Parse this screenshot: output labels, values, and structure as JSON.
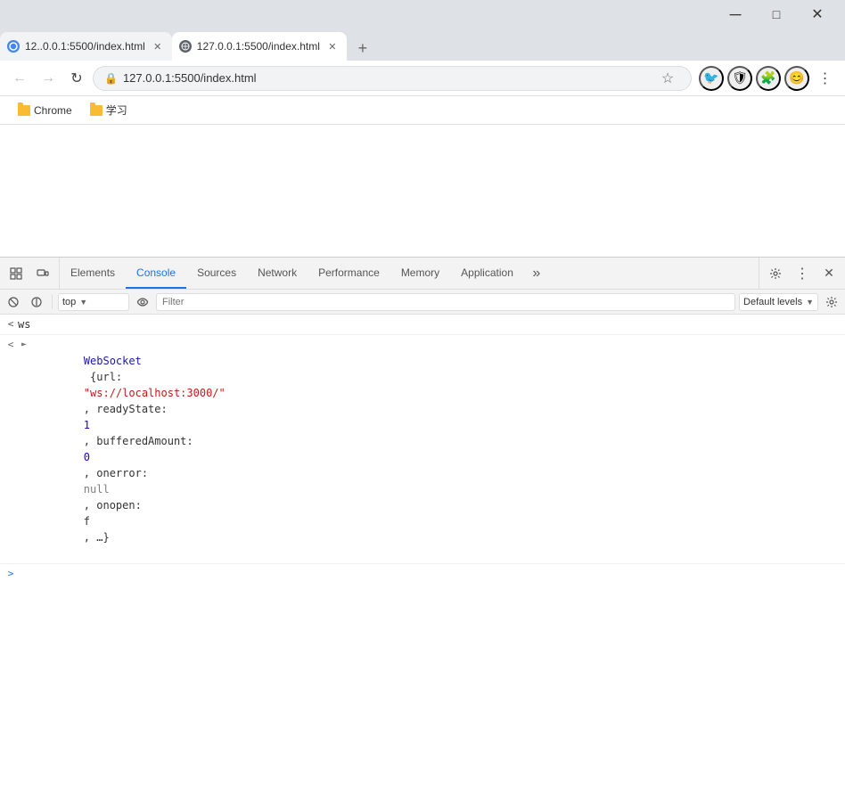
{
  "window": {
    "min_btn": "─",
    "max_btn": "□",
    "close_btn": "✕"
  },
  "tabs": [
    {
      "id": "tab1",
      "favicon": "loading",
      "title": "12..0.0.1:5500/index.html",
      "active": false,
      "url": "127.0.0.1:5500/index.html"
    },
    {
      "id": "tab2",
      "favicon": "globe",
      "title": "127.0.0.1:5500/index.html",
      "active": true,
      "url": "127.0.0.1:5500/index.html"
    }
  ],
  "new_tab_label": "+",
  "navbar": {
    "back_disabled": true,
    "forward_disabled": true,
    "reload": "↻",
    "address": "127.0.0.1:5500/index.html",
    "full_address": "http://127.0.0.1:5500/index.html",
    "star": "☆",
    "extensions": [
      "🐦",
      "🛡",
      "🧩",
      "😊"
    ],
    "menu": "⋮"
  },
  "bookmarks": [
    {
      "label": "Chrome",
      "type": "folder"
    },
    {
      "label": "学习",
      "type": "folder"
    }
  ],
  "devtools": {
    "tabs": [
      {
        "id": "elements",
        "label": "Elements",
        "active": false
      },
      {
        "id": "console",
        "label": "Console",
        "active": true
      },
      {
        "id": "sources",
        "label": "Sources",
        "active": false
      },
      {
        "id": "network",
        "label": "Network",
        "active": false
      },
      {
        "id": "performance",
        "label": "Performance",
        "active": false
      },
      {
        "id": "memory",
        "label": "Memory",
        "active": false
      },
      {
        "id": "application",
        "label": "Application",
        "active": false
      }
    ],
    "more_tabs_label": "»",
    "toolbar": {
      "context": "top",
      "filter_placeholder": "Filter",
      "level": "Default levels"
    },
    "console_entries": [
      {
        "type": "log",
        "arrow": "<",
        "expand": false,
        "text_plain": "ws"
      },
      {
        "type": "log",
        "arrow": "<",
        "expand": true,
        "text_parts": [
          {
            "kind": "type",
            "value": "WebSocket"
          },
          {
            "kind": "plain",
            "value": " {url: "
          },
          {
            "kind": "string",
            "value": "\"ws://localhost:3000/\""
          },
          {
            "kind": "plain",
            "value": ", readyState: "
          },
          {
            "kind": "number",
            "value": "1"
          },
          {
            "kind": "plain",
            "value": ", bufferedAmount: "
          },
          {
            "kind": "number",
            "value": "0"
          },
          {
            "kind": "plain",
            "value": ", onerror: "
          },
          {
            "kind": "null",
            "value": "null"
          },
          {
            "kind": "plain",
            "value": ", onopen: "
          },
          {
            "kind": "func",
            "value": "f"
          },
          {
            "kind": "plain",
            "value": ", …}"
          }
        ]
      }
    ]
  }
}
